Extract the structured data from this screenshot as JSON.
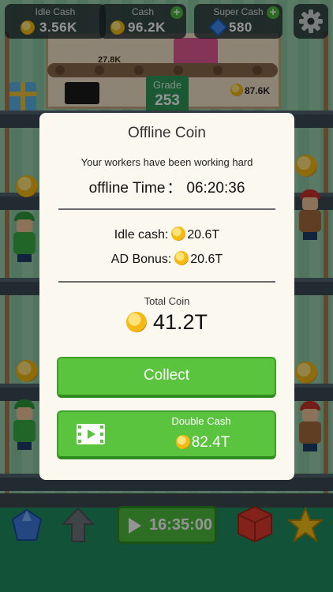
{
  "topbar": {
    "idle_cash": {
      "label": "Idle Cash",
      "value": "3.56K"
    },
    "cash": {
      "label": "Cash",
      "value": "96.2K",
      "plus": "+"
    },
    "super_cash": {
      "label": "Super Cash",
      "value": "580",
      "plus": "+"
    }
  },
  "scene": {
    "conveyor_value": "27.8K",
    "grade_label": "Grade",
    "grade_value": "253",
    "shaft_cash": "87.6K"
  },
  "dialog": {
    "title": "Offline Coin",
    "subtitle": "Your workers have been working hard",
    "offline_time_label": "offline Time",
    "offline_time_sep": "：",
    "offline_time_value": "06:20:36",
    "idle_cash_label": "Idle cash:",
    "idle_cash_value": "20.6T",
    "ad_bonus_label": "AD Bonus:",
    "ad_bonus_value": "20.6T",
    "total_label": "Total Coin",
    "total_value": "41.2T",
    "collect_label": "Collect",
    "double_label": "Double Cash",
    "double_value": "82.4T"
  },
  "bottombar": {
    "timer": "16:35:00"
  },
  "colors": {
    "button_green": "#5bc43e",
    "dialog_bg": "#fbf8ef",
    "coin_gold": "#f5b914",
    "bottom_green": "#1f8e62"
  }
}
